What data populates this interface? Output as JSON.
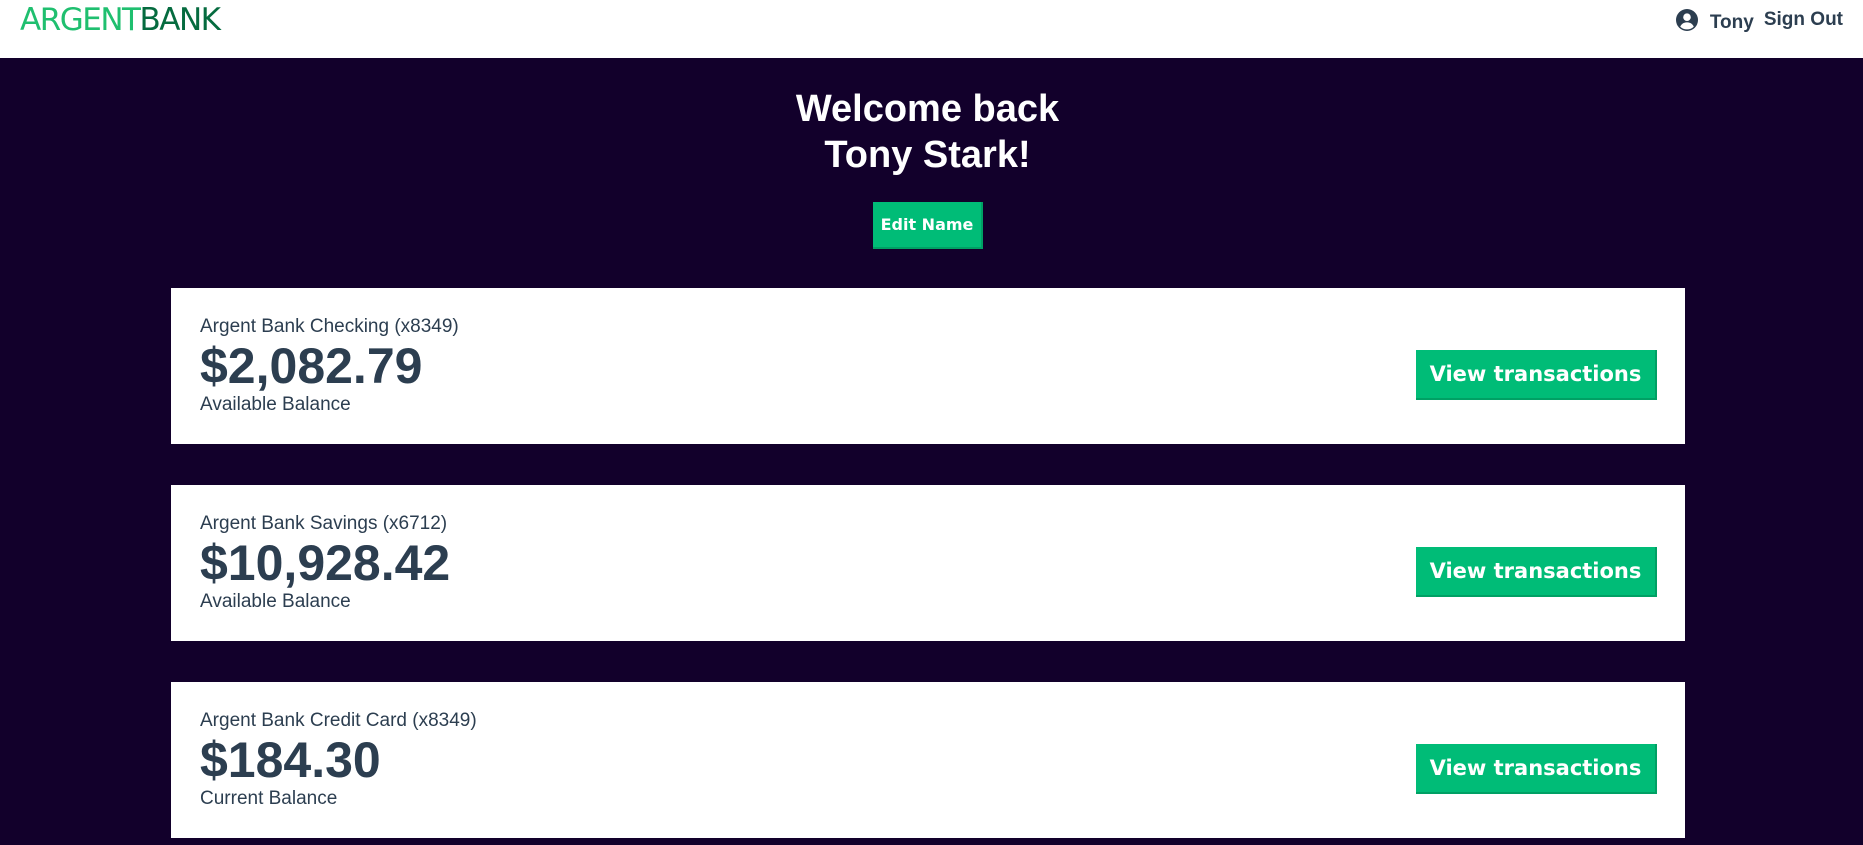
{
  "header": {
    "logo_part1": "ARGENT",
    "logo_part2": "BANK",
    "user_icon": "user-circle-icon",
    "user_name": "Tony",
    "sign_out": "Sign Out"
  },
  "welcome": {
    "line1": "Welcome back",
    "line2": "Tony Stark!",
    "edit_button": "Edit Name"
  },
  "accounts": [
    {
      "title": "Argent Bank Checking (x8349)",
      "amount": "$2,082.79",
      "description": "Available Balance",
      "button": "View transactions"
    },
    {
      "title": "Argent Bank Savings (x6712)",
      "amount": "$10,928.42",
      "description": "Available Balance",
      "button": "View transactions"
    },
    {
      "title": "Argent Bank Credit Card (x8349)",
      "amount": "$184.30",
      "description": "Current Balance",
      "button": "View transactions"
    }
  ],
  "colors": {
    "background": "#12002b",
    "accent": "#00bc77",
    "logo_light": "#1fbf6f",
    "logo_dark": "#056b3f",
    "text": "#2c3e50"
  }
}
